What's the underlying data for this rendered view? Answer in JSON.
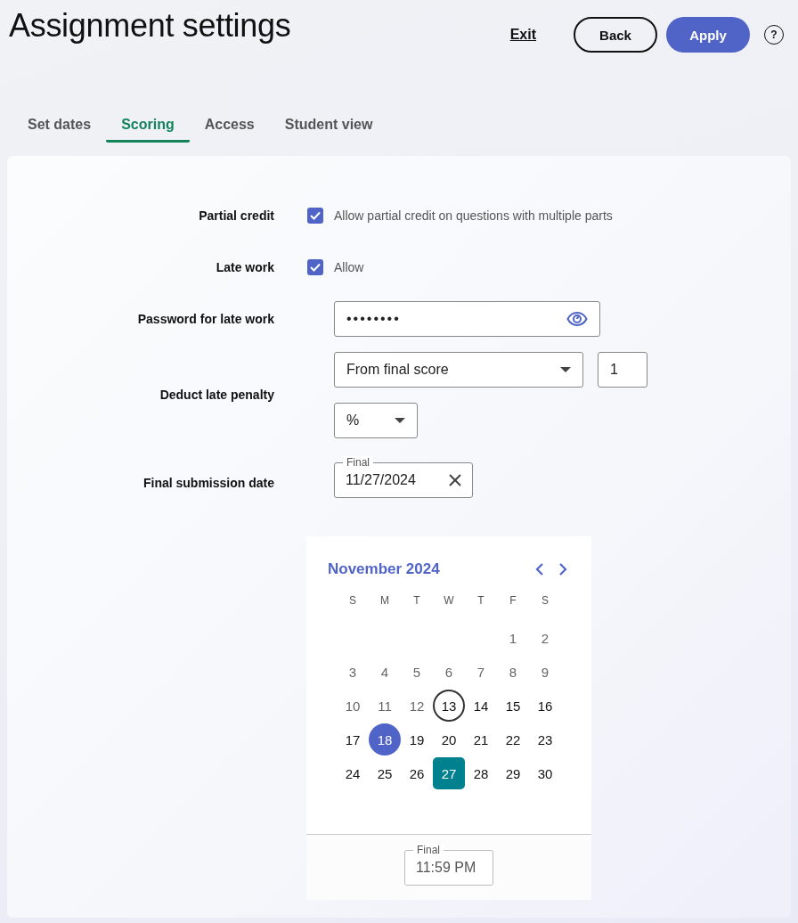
{
  "title": "Assignment settings",
  "actions": {
    "exit": "Exit",
    "back": "Back",
    "apply": "Apply",
    "help": "?"
  },
  "tabs": [
    {
      "label": "Set dates",
      "selected": false
    },
    {
      "label": "Scoring",
      "selected": true
    },
    {
      "label": "Access",
      "selected": false
    },
    {
      "label": "Student view",
      "selected": false
    }
  ],
  "settings": [
    {
      "kind": "checkbox",
      "label": "Partial credit",
      "text": "Allow partial credit on questions with multiple parts",
      "checked": true
    },
    {
      "kind": "checkbox",
      "label": "Late work",
      "text": "Allow",
      "checked": true
    },
    {
      "kind": "password",
      "label": "Password for late work",
      "value": "••••••••"
    },
    {
      "kind": "penalty",
      "label": "Deduct late penalty",
      "mode": "From final score",
      "amount": "1",
      "unit": "%"
    },
    {
      "kind": "date",
      "label": "Final submission date",
      "legend": "Final",
      "value": "11/27/2024"
    }
  ],
  "calendar": {
    "month": "November 2024",
    "weekdays": [
      "S",
      "M",
      "T",
      "W",
      "T",
      "F",
      "S"
    ],
    "weeks": [
      [
        {
          "label": "1",
          "kind": "past",
          "selected": false
        },
        {
          "label": "2",
          "kind": "past",
          "selected": false
        }
      ],
      [
        {
          "label": "3",
          "kind": "past",
          "selected": false
        },
        {
          "label": "4",
          "kind": "past",
          "selected": false
        },
        {
          "label": "5",
          "kind": "past",
          "selected": false
        },
        {
          "label": "6",
          "kind": "past",
          "selected": false
        },
        {
          "label": "7",
          "kind": "past",
          "selected": false
        },
        {
          "label": "8",
          "kind": "past",
          "selected": false
        },
        {
          "label": "9",
          "kind": "past",
          "selected": false
        }
      ],
      [
        {
          "label": "10",
          "kind": "past",
          "selected": false
        },
        {
          "label": "11",
          "kind": "past",
          "selected": false
        },
        {
          "label": "12",
          "kind": "past",
          "selected": false
        },
        {
          "label": "13",
          "kind": "today",
          "selected": false
        },
        {
          "label": "14",
          "kind": "future",
          "selected": false
        },
        {
          "label": "15",
          "kind": "future",
          "selected": false
        },
        {
          "label": "16",
          "kind": "future",
          "selected": false
        }
      ],
      [
        {
          "label": "17",
          "kind": "future",
          "selected": false
        },
        {
          "label": "18",
          "kind": "marked",
          "selected": false
        },
        {
          "label": "19",
          "kind": "future",
          "selected": false
        },
        {
          "label": "20",
          "kind": "future",
          "selected": false
        },
        {
          "label": "21",
          "kind": "future",
          "selected": false
        },
        {
          "label": "22",
          "kind": "future",
          "selected": false
        },
        {
          "label": "23",
          "kind": "future",
          "selected": false
        }
      ],
      [
        {
          "label": "24",
          "kind": "future",
          "selected": false
        },
        {
          "label": "25",
          "kind": "future",
          "selected": false
        },
        {
          "label": "26",
          "kind": "future",
          "selected": false
        },
        {
          "label": "27",
          "kind": "future",
          "selected": true
        },
        {
          "label": "28",
          "kind": "future",
          "selected": false
        },
        {
          "label": "29",
          "kind": "future",
          "selected": false
        },
        {
          "label": "30",
          "kind": "future",
          "selected": false
        }
      ]
    ],
    "time": {
      "legend": "Final",
      "value": "11:59 PM"
    }
  }
}
